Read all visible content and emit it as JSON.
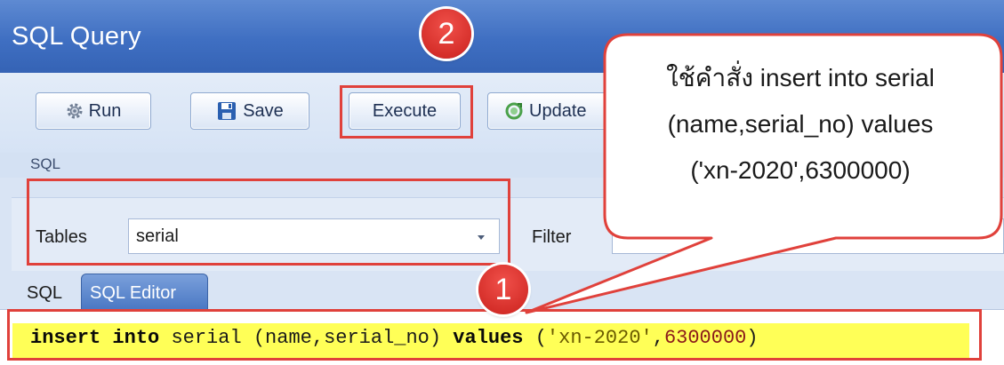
{
  "window": {
    "title": "SQL Query"
  },
  "toolbar": {
    "run_label": "Run",
    "save_label": "Save",
    "execute_label": "Execute",
    "update_label": "Update"
  },
  "section": {
    "sql_label": "SQL"
  },
  "tables": {
    "label": "Tables",
    "selected": "serial"
  },
  "filter": {
    "label": "Filter",
    "value": ""
  },
  "tabs": [
    {
      "label": "SQL"
    },
    {
      "label": "SQL Editor"
    }
  ],
  "editor": {
    "kw_insert": "insert",
    "kw_into": "into",
    "table_cols": "serial (name,serial_no)",
    "kw_values": "values",
    "open": "(",
    "string_value": "'xn-2020'",
    "comma": ",",
    "number_value": "6300000",
    "close": ")"
  },
  "annotations": {
    "badge1": "1",
    "badge2": "2",
    "callout_line1": "ใช้คำสั่ง insert into serial",
    "callout_line2": "(name,serial_no) values",
    "callout_line3": "('xn-2020',6300000)",
    "highlight_color": "#e0413b"
  }
}
